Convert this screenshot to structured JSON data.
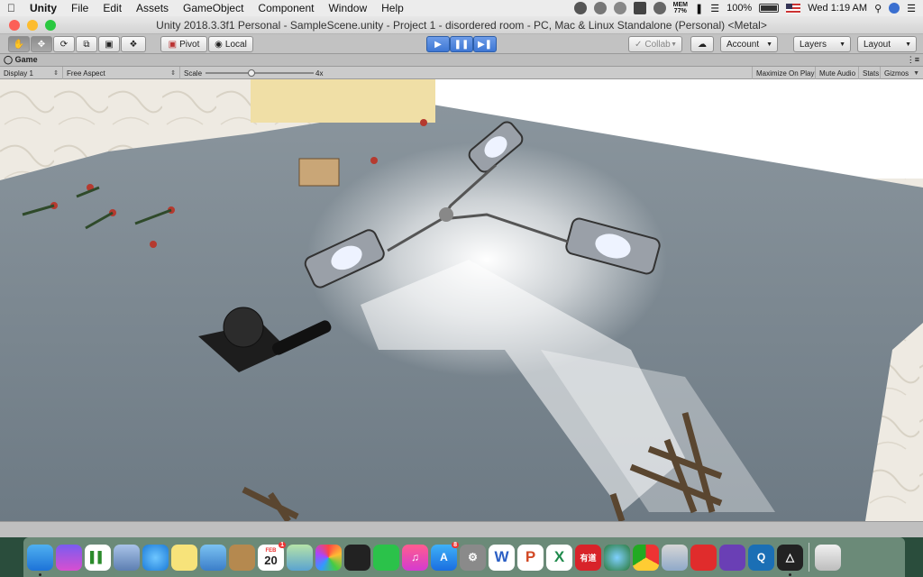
{
  "menubar": {
    "app_name": "Unity",
    "items": [
      "File",
      "Edit",
      "Assets",
      "GameObject",
      "Component",
      "Window",
      "Help"
    ],
    "mem_label": "MEM",
    "mem_value": "77%",
    "battery": "100%",
    "clock": "Wed 1:19 AM"
  },
  "window": {
    "title": "Unity 2018.3.3f1 Personal - SampleScene.unity - Project 1 - disordered room - PC, Mac & Linux Standalone (Personal) <Metal>"
  },
  "toolbar": {
    "pivot": "Pivot",
    "local": "Local",
    "collab": "Collab",
    "account": "Account",
    "layers": "Layers",
    "layout": "Layout"
  },
  "game_tab": {
    "title": "Game",
    "display": "Display 1",
    "aspect": "Free Aspect",
    "scale_label": "Scale",
    "scale_value": "4x",
    "maximize": "Maximize On Play",
    "mute": "Mute Audio",
    "stats": "Stats",
    "gizmos": "Gizmos"
  },
  "dock": {
    "calendar_month": "FEB",
    "calendar_day": "20",
    "calendar_badge": "1",
    "appstore_badge": "8",
    "youdao_label": "有道"
  },
  "colors": {
    "accent_blue": "#3e77d4",
    "floor": "#7d8a94",
    "toolbar": "#c2c2c2"
  }
}
